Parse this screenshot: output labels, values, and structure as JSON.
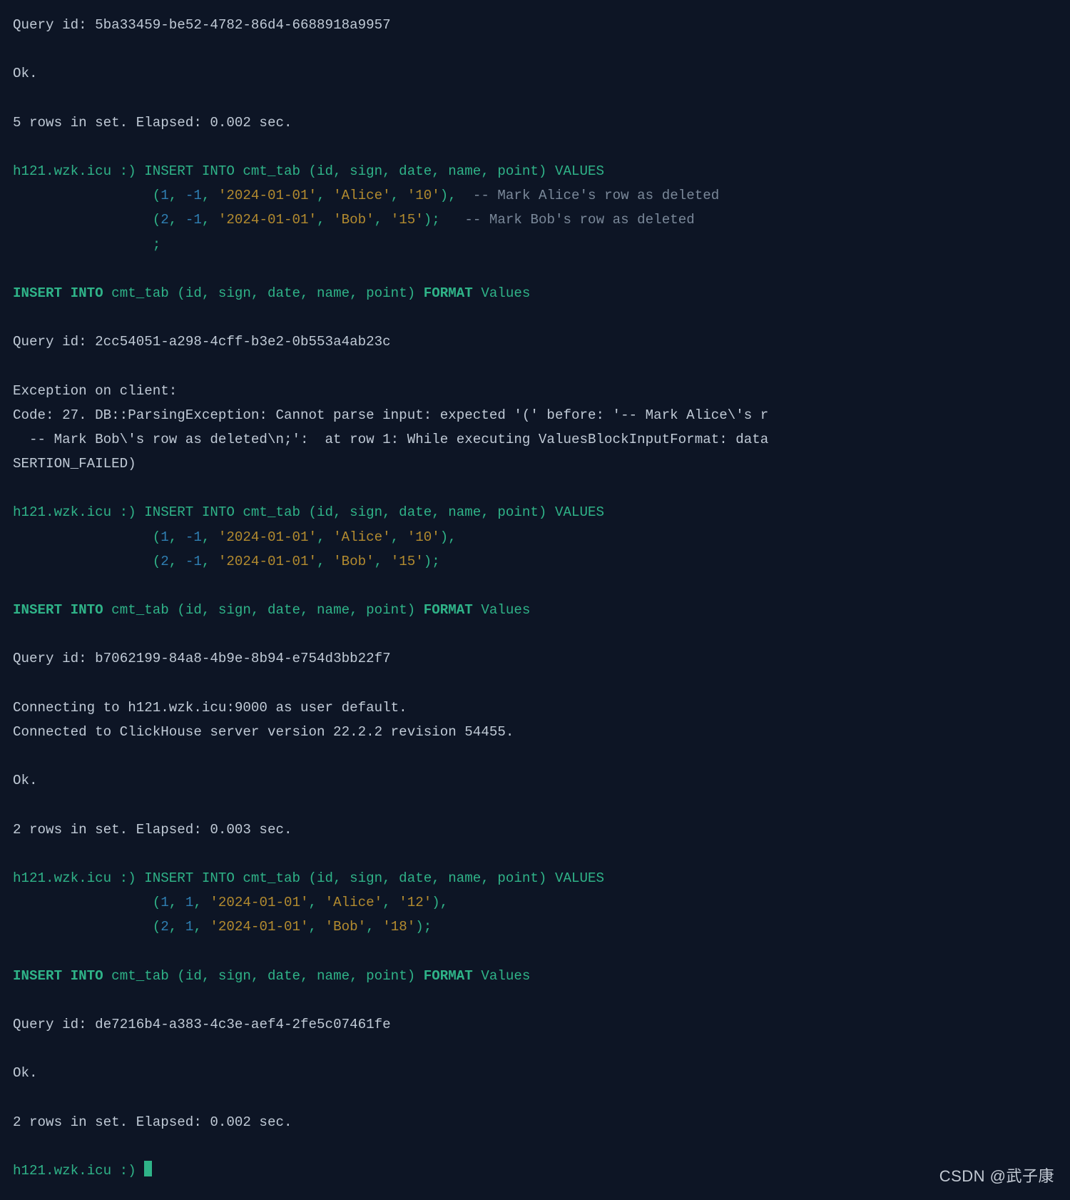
{
  "prompt_host": "h121.wzk.icu :) ",
  "indent": "                 ",
  "ok": "Ok.",
  "watermark": "CSDN @武子康",
  "query_id_label": "Query id: ",
  "exception_header": "Exception on client:",
  "block1": {
    "query_id": "5ba33459-be52-4782-86d4-6688918a9957",
    "rows_line": "5 rows in set. Elapsed: 0.002 sec."
  },
  "insert1": {
    "head": "INSERT INTO cmt_tab (id, sign, date, name, point) VALUES",
    "row1": {
      "open": "(",
      "v1": "1",
      "c1": ", ",
      "v2": "-1",
      "c2": ", ",
      "v3": "'2024-01-01'",
      "c3": ", ",
      "v4": "'Alice'",
      "c4": ", ",
      "v5": "'10'",
      "close": "),  ",
      "comment": "-- Mark Alice's row as deleted"
    },
    "row2": {
      "open": "(",
      "v1": "2",
      "c1": ", ",
      "v2": "-1",
      "c2": ", ",
      "v3": "'2024-01-01'",
      "c3": ", ",
      "v4": "'Bob'",
      "c4": ", ",
      "v5": "'15'",
      "close": ");   ",
      "comment": "-- Mark Bob's row as deleted"
    },
    "trailer": ";"
  },
  "echo": {
    "pre": "INSERT INTO",
    "mid": " cmt_tab (id, sign, date, name, point) ",
    "fmt": "FORMAT",
    "tail": " Values"
  },
  "block2": {
    "query_id": "2cc54051-a298-4cff-b3e2-0b553a4ab23c",
    "err1": "Code: 27. DB::ParsingException: Cannot parse input: expected '(' before: '-- Mark Alice\\'s r",
    "err2": "  -- Mark Bob\\'s row as deleted\\n;':  at row 1: While executing ValuesBlockInputFormat: data",
    "err3": "SERTION_FAILED)"
  },
  "insert2": {
    "head": "INSERT INTO cmt_tab (id, sign, date, name, point) VALUES",
    "row1": {
      "open": "(",
      "v1": "1",
      "c1": ", ",
      "v2": "-1",
      "c2": ", ",
      "v3": "'2024-01-01'",
      "c3": ", ",
      "v4": "'Alice'",
      "c4": ", ",
      "v5": "'10'",
      "close": "),"
    },
    "row2": {
      "open": "(",
      "v1": "2",
      "c1": ", ",
      "v2": "-1",
      "c2": ", ",
      "v3": "'2024-01-01'",
      "c3": ", ",
      "v4": "'Bob'",
      "c4": ", ",
      "v5": "'15'",
      "close": ");"
    }
  },
  "block3": {
    "query_id": "b7062199-84a8-4b9e-8b94-e754d3bb22f7",
    "conn1": "Connecting to h121.wzk.icu:9000 as user default.",
    "conn2": "Connected to ClickHouse server version 22.2.2 revision 54455.",
    "rows_line": "2 rows in set. Elapsed: 0.003 sec."
  },
  "insert3": {
    "head": "INSERT INTO cmt_tab (id, sign, date, name, point) VALUES",
    "row1": {
      "open": "(",
      "v1": "1",
      "c1": ", ",
      "v2": "1",
      "c2": ", ",
      "v3": "'2024-01-01'",
      "c3": ", ",
      "v4": "'Alice'",
      "c4": ", ",
      "v5": "'12'",
      "close": "),"
    },
    "row2": {
      "open": "(",
      "v1": "2",
      "c1": ", ",
      "v2": "1",
      "c2": ", ",
      "v3": "'2024-01-01'",
      "c3": ", ",
      "v4": "'Bob'",
      "c4": ", ",
      "v5": "'18'",
      "close": ");"
    }
  },
  "block4": {
    "query_id": "de7216b4-a383-4c3e-aef4-2fe5c07461fe",
    "rows_line": "2 rows in set. Elapsed: 0.002 sec."
  }
}
